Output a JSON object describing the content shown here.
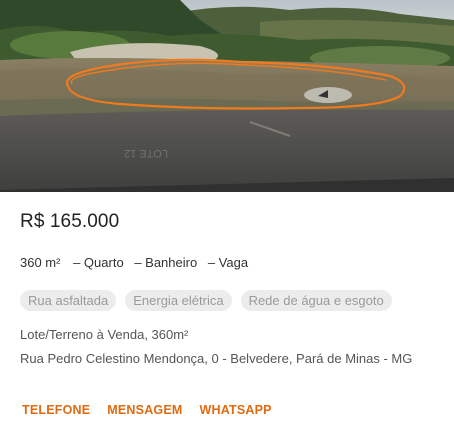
{
  "listing": {
    "price": "R$ 165.000",
    "features": {
      "area": "360 m²",
      "items": [
        "– Quarto",
        "– Banheiro",
        "– Vaga"
      ]
    },
    "tags": [
      "Rua asfaltada",
      "Energia elétrica",
      "Rede de água e esgoto"
    ],
    "description": "Lote/Terreno à Venda, 360m²",
    "address": "Rua Pedro Celestino Mendonça, 0 - Belvedere, Pará de Minas - MG",
    "actions": {
      "phone_label": "TELEFONE",
      "message_label": "MENSAGEM",
      "whatsapp_label": "WHATSAPP"
    }
  },
  "colors": {
    "accent": "#e06a10",
    "tag_background": "#ececec",
    "tag_text": "#9a9a9a",
    "highlight_stroke": "#f07a1e"
  }
}
